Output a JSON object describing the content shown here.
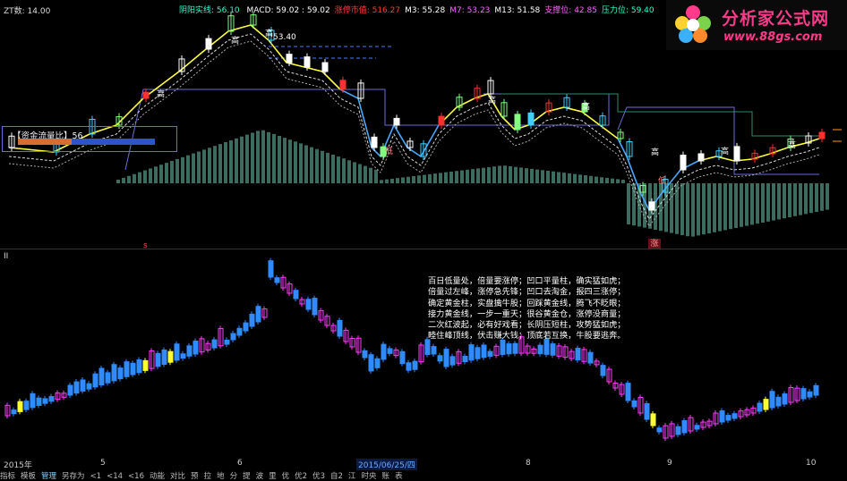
{
  "indicator_row": [
    {
      "label": "",
      "value": "MACD: 59.02 : 59.02",
      "color": "#ffffff"
    },
    {
      "label": "",
      "value": "涨停市值: 516.27",
      "color": "#ff3b3b"
    },
    {
      "label": "",
      "value": "M3: 55.28",
      "color": "#ffffff"
    },
    {
      "label": "",
      "value": "M7: 53.23",
      "color": "#ff66ff"
    },
    {
      "label": "",
      "value": "M13: 51.58",
      "color": "#ffffff"
    },
    {
      "label": "",
      "value": "支撑位: 42.85",
      "color": "#ff66ff"
    },
    {
      "label": "",
      "value": "压力位: 59.40",
      "color": "#33ffcc"
    }
  ],
  "indicator_prefix": "阴阳实线: 56.10",
  "zt_row": "ZT数: 14.00",
  "main_chart": {
    "price_label": "53.40",
    "funds_label": "【资金流量比】56",
    "funds_fill_fraction": 0.4,
    "high_markers": [
      "高",
      "高",
      "高",
      "高",
      "高",
      "高",
      "高",
      "高"
    ],
    "low_markers": [
      "低",
      "低"
    ],
    "zhang_tag": "涨",
    "s_tag": "s"
  },
  "sub_chart": {
    "label": "II"
  },
  "logo": {
    "main": "分析家公式网",
    "url": "www.88gs.com"
  },
  "rhyme_lines": [
    "百日低量处，倍量要涨停；凹口平量柱，确实猛如虎；",
    "倍量过左峰，涨停急先锋；凹口去淘金，报四三涨停；",
    "确定黄金柱，实盘擒牛股；回踩黄金线，腾飞不眨眼；",
    "接力黄金线，一步一重天；很谷黄金仓，涨停没商量；",
    "二次红波起，必有好戏看；长阴压短柱，攻势猛如虎；",
    "睦住峰顶线，伏击赚大钱；顶底若互换，牛股要逃奔。"
  ],
  "axis": {
    "ticks": [
      {
        "label": "2015年"
      },
      {
        "label": "5"
      },
      {
        "label": "6"
      },
      {
        "label": "2015/06/25/四",
        "highlight": true
      },
      {
        "label": "8"
      },
      {
        "label": "9"
      },
      {
        "label": "10"
      }
    ]
  },
  "toolbar": [
    {
      "label": "指标",
      "active": false
    },
    {
      "label": "模板",
      "active": false
    },
    {
      "label": "管理",
      "active": true
    },
    {
      "label": "另存为",
      "active": false
    },
    {
      "label": "<1",
      "active": false
    },
    {
      "label": "<14",
      "active": false
    },
    {
      "label": "<16",
      "active": false
    },
    {
      "label": "动能",
      "active": false
    },
    {
      "label": "对比",
      "active": false
    },
    {
      "label": "预",
      "active": false
    },
    {
      "label": "拉",
      "active": false
    },
    {
      "label": "地",
      "active": false
    },
    {
      "label": "分",
      "active": false
    },
    {
      "label": "提",
      "active": false
    },
    {
      "label": "波",
      "active": false
    },
    {
      "label": "里",
      "active": false
    },
    {
      "label": "优",
      "active": false
    },
    {
      "label": "优2",
      "active": false
    },
    {
      "label": "优3",
      "active": false
    },
    {
      "label": "自2",
      "active": false
    },
    {
      "label": "江",
      "active": false
    },
    {
      "label": "时央",
      "active": false
    },
    {
      "label": "账",
      "active": false
    },
    {
      "label": "表",
      "active": false
    }
  ]
}
